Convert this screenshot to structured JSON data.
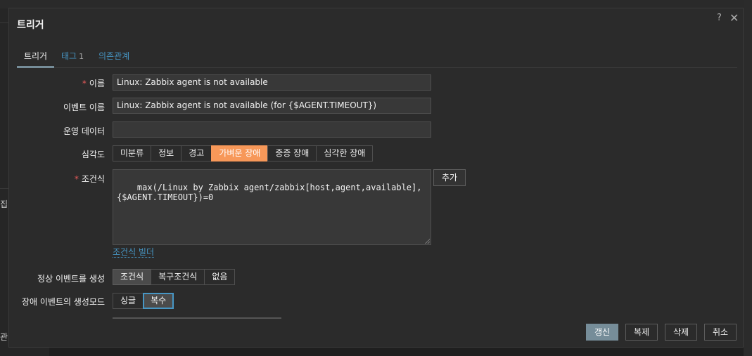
{
  "background": {
    "left_text_1": "집",
    "left_text_2": "관"
  },
  "modal": {
    "title": "트리거",
    "help_glyph": "?",
    "close_glyph": "✕"
  },
  "tabs": [
    {
      "label": "트리거",
      "active": true
    },
    {
      "label": "태그",
      "count": "1"
    },
    {
      "label": "의존관계"
    }
  ],
  "form": {
    "name": {
      "label": "이름",
      "required": "*",
      "value": "Linux: Zabbix agent is not available"
    },
    "event_name": {
      "label": "이벤트 이름",
      "value": "Linux: Zabbix agent is not available (for {$AGENT.TIMEOUT})"
    },
    "opdata": {
      "label": "운영 데이터",
      "value": ""
    },
    "severity": {
      "label": "심각도",
      "options": [
        "미분류",
        "정보",
        "경고",
        "가벼운 장애",
        "중증 장애",
        "심각한 장애"
      ],
      "selected": "가벼운 장애"
    },
    "expression": {
      "label": "조건식",
      "required": "*",
      "value": "max(/Linux by Zabbix agent/zabbix[host,agent,available],\n{$AGENT.TIMEOUT})=0",
      "add_button": "추가",
      "builder_link": "조건식 빌더"
    },
    "ok_event": {
      "label": "정상 이벤트를 생성",
      "options": [
        "조건식",
        "복구조건식",
        "없음"
      ],
      "selected": "조건식"
    },
    "problem_mode": {
      "label": "장애 이벤트의 생성모드",
      "options": [
        "싱글",
        "복수"
      ],
      "selected": "복수"
    }
  },
  "footer": {
    "update": "갱신",
    "clone": "복제",
    "delete": "삭제",
    "cancel": "취소"
  },
  "colors": {
    "accent_orange": "#f79859",
    "link_blue": "#4796c4",
    "primary_button": "#768d99"
  }
}
